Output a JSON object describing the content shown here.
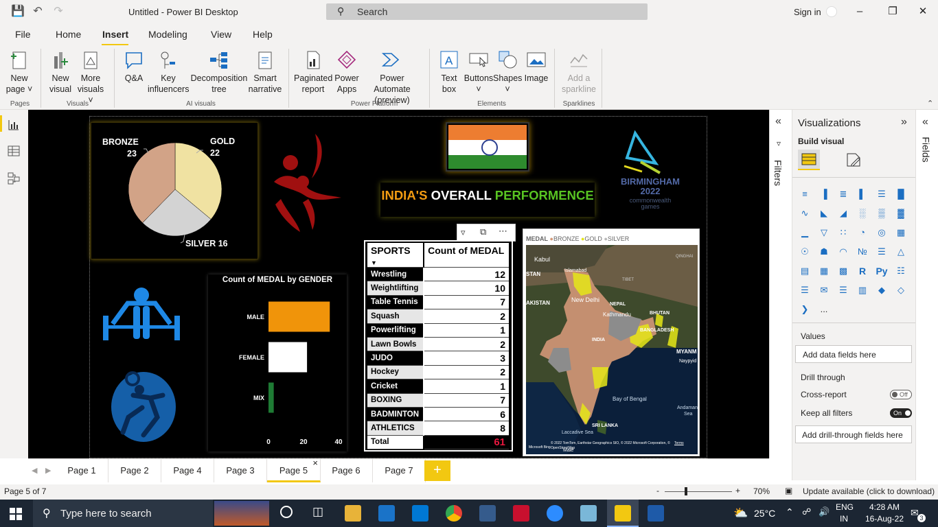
{
  "app": {
    "title": "Untitled - Power BI Desktop",
    "search_placeholder": "Search",
    "sign_in": "Sign in"
  },
  "menu": [
    "File",
    "Home",
    "Insert",
    "Modeling",
    "View",
    "Help"
  ],
  "ribbon": {
    "new_page": [
      "New",
      "page"
    ],
    "new_visual": [
      "New",
      "visual"
    ],
    "more_visuals": [
      "More",
      "visuals"
    ],
    "qa": "Q&A",
    "key_influencers": [
      "Key",
      "influencers"
    ],
    "decomposition_tree": [
      "Decomposition",
      "tree"
    ],
    "smart_narrative": [
      "Smart",
      "narrative"
    ],
    "paginated_report": [
      "Paginated",
      "report"
    ],
    "power_apps": [
      "Power",
      "Apps"
    ],
    "power_automate": [
      "Power Automate",
      "(preview)"
    ],
    "text_box": [
      "Text",
      "box"
    ],
    "buttons": "Buttons",
    "shapes": "Shapes",
    "image": "Image",
    "sparkline": [
      "Add a",
      "sparkline"
    ],
    "groups": {
      "pages": "Pages",
      "visuals": "Visuals",
      "ai_visuals": "AI visuals",
      "power_platform": "Power Platform",
      "elements": "Elements",
      "sparklines": "Sparklines"
    }
  },
  "report": {
    "pie": {
      "bronze_label": "BRONZE",
      "bronze_value": "23",
      "gold_label": "GOLD",
      "gold_value": "22",
      "silver_label": "SILVER 16"
    },
    "heading": {
      "india": "INDIA'S",
      "overall": "OVERALL",
      "performence": "PERFORMENCE"
    },
    "birmingham": {
      "line1": "BIRMINGHAM",
      "line2": "2022",
      "line3": "commonwealth",
      "line4": "games"
    },
    "gender_chart_title": "Count of MEDAL by GENDER",
    "map": {
      "legend_title": "MEDAL",
      "legend": [
        {
          "name": "BRONZE",
          "color": "#d49a79"
        },
        {
          "name": "GOLD",
          "color": "#e5e617"
        },
        {
          "name": "SILVER",
          "color": "#b8b8b8"
        }
      ],
      "labels": {
        "kabul": "Kabul",
        "islamabad": "Islamabad",
        "tibet": "TIBET",
        "qinghai": "QINGHAI",
        "stan": "STAN",
        "akistan": "AKISTAN",
        "new_delhi": "New Delhi",
        "nepal": "NEPAL",
        "kathmandu": "Kathmandu",
        "bhutan": "BHUTAN",
        "bangladesh": "BANGLADESH",
        "india": "INDIA",
        "myanmar": "MYANM",
        "naypyidaw": "Naypyid",
        "bay_of_bengal": "Bay of Bengal",
        "andaman": "Andaman",
        "sea": "Sea",
        "sri_lanka": "SRI LANKA",
        "laccadive": "Laccadive Sea",
        "male": "Malé",
        "bing": "Microsoft Bing",
        "copyright": "© 2022 TomTom, Earthstar Geographics SIO, © 2022 Microsoft Corporation, © OpenStreetMap",
        "terms": "Terms"
      }
    },
    "table": {
      "headers": [
        "SPORTS",
        "Count of MEDAL"
      ],
      "rows": [
        {
          "sport": "Wrestling",
          "count": "12"
        },
        {
          "sport": "Weightlifting",
          "count": "10"
        },
        {
          "sport": "Table Tennis",
          "count": "7"
        },
        {
          "sport": "Squash",
          "count": "2"
        },
        {
          "sport": "Powerlifting",
          "count": "1"
        },
        {
          "sport": "Lawn Bowls",
          "count": "2"
        },
        {
          "sport": "JUDO",
          "count": "3"
        },
        {
          "sport": "Hockey",
          "count": "2"
        },
        {
          "sport": "Cricket",
          "count": "1"
        },
        {
          "sport": "BOXING",
          "count": "7"
        },
        {
          "sport": "BADMINTON",
          "count": "6"
        },
        {
          "sport": "ATHLETICS",
          "count": "8"
        }
      ],
      "total_label": "Total",
      "total_value": "61"
    }
  },
  "chart_data": [
    {
      "type": "pie",
      "categories": [
        "GOLD",
        "SILVER",
        "BRONZE"
      ],
      "values": [
        22,
        16,
        23
      ],
      "colors": [
        "#f0e2a2",
        "#d3d3d3",
        "#d2a387"
      ]
    },
    {
      "type": "bar",
      "title": "Count of MEDAL by GENDER",
      "categories": [
        "MALE",
        "FEMALE",
        "MIX"
      ],
      "values": [
        35,
        22,
        3
      ],
      "colors": [
        "#f0940a",
        "#ffffff",
        "#1e7b34"
      ],
      "xlim": [
        0,
        40
      ],
      "xticks": [
        "0",
        "20",
        "40"
      ]
    }
  ],
  "filters_label": "Filters",
  "visualizations": {
    "title": "Visualizations",
    "build_visual": "Build visual",
    "values_label": "Values",
    "add_data_fields": "Add data fields here",
    "drill_through": "Drill through",
    "cross_report": "Cross-report",
    "cross_report_state": "Off",
    "keep_all_filters": "Keep all filters",
    "keep_all_filters_state": "On",
    "add_drill_through": "Add drill-through fields here",
    "r_label": "R",
    "py_label": "Py",
    "more": "..."
  },
  "fields_label": "Fields",
  "pages": [
    "Page 1",
    "Page 2",
    "Page 4",
    "Page 3",
    "Page 5",
    "Page 6",
    "Page 7"
  ],
  "active_page": "Page 5",
  "add_page": "+",
  "status": {
    "page_of": "Page 5 of 7",
    "zoom_minus": "-",
    "zoom_plus": "+",
    "zoom": "70%",
    "update": "Update available (click to download)"
  },
  "taskbar": {
    "search_placeholder": "Type here to search",
    "weather": "25°C",
    "lang1": "ENG",
    "lang2": "IN",
    "time": "4:28 AM",
    "date": "16-Aug-22",
    "notif_count": "3"
  }
}
